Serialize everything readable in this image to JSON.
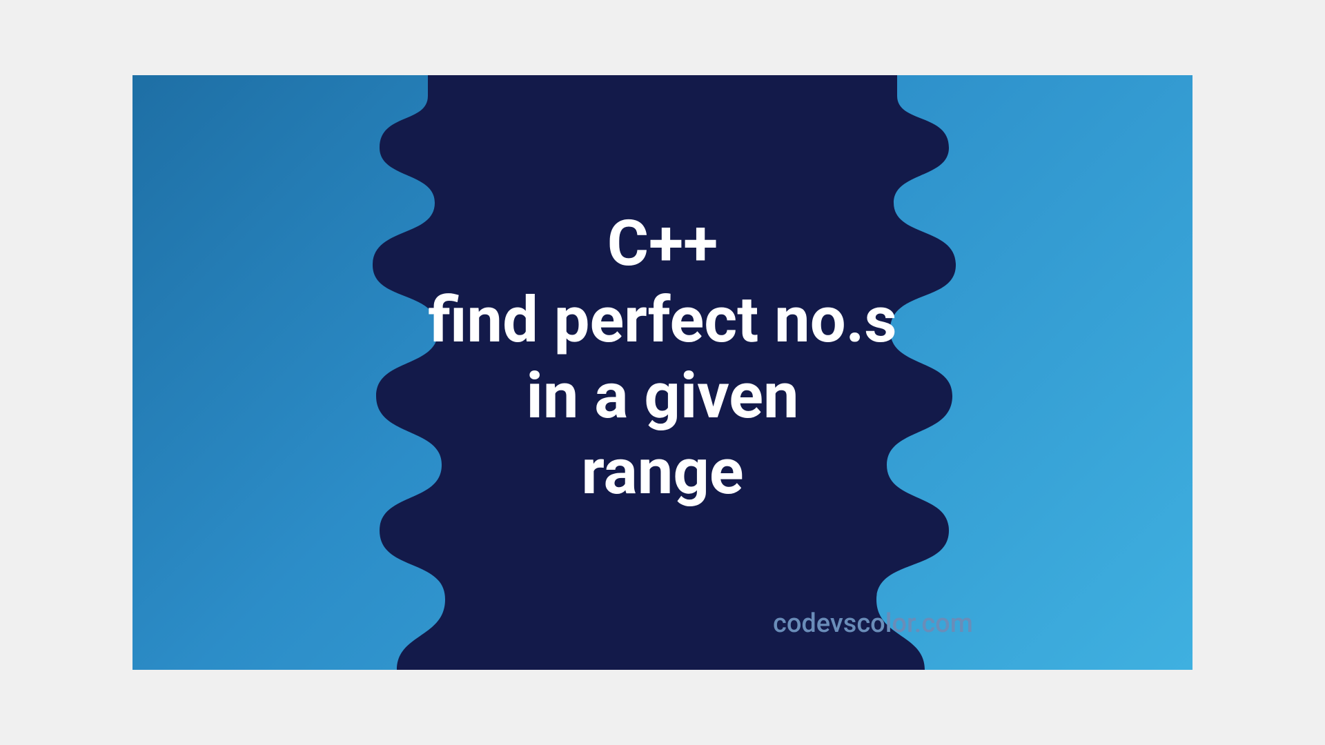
{
  "banner": {
    "title_line1": "C++",
    "title_line2": "find perfect no.s",
    "title_line3": "in a given",
    "title_line4": "range",
    "watermark": "codevscolor.com"
  },
  "colors": {
    "blob_fill": "#131a4a",
    "gradient_start": "#1e6fa5",
    "gradient_end": "#3fb0e0",
    "text": "#ffffff",
    "watermark": "#6a8db9"
  }
}
